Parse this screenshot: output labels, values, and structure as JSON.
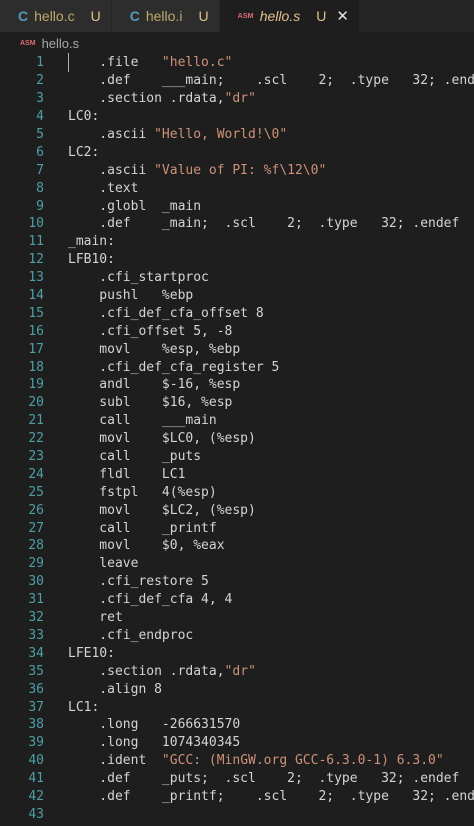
{
  "tabs": [
    {
      "icon": "C",
      "name": "hello.c",
      "status": "U"
    },
    {
      "icon": "C",
      "name": "hello.i",
      "status": "U"
    },
    {
      "icon": "ASM",
      "name": "hello.s",
      "status": "U",
      "close": "✕"
    }
  ],
  "breadcrumb": {
    "icon": "ASM",
    "file": "hello.s"
  },
  "lines": [
    "    .file   \"hello.c\"",
    "    .def    ___main;    .scl    2;  .type   32; .endef",
    "    .section .rdata,\"dr\"",
    "LC0:",
    "    .ascii \"Hello, World!\\0\"",
    "LC2:",
    "    .ascii \"Value of PI: %f\\12\\0\"",
    "    .text",
    "    .globl  _main",
    "    .def    _main;  .scl    2;  .type   32; .endef",
    "_main:",
    "LFB10:",
    "    .cfi_startproc",
    "    pushl   %ebp",
    "    .cfi_def_cfa_offset 8",
    "    .cfi_offset 5, -8",
    "    movl    %esp, %ebp",
    "    .cfi_def_cfa_register 5",
    "    andl    $-16, %esp",
    "    subl    $16, %esp",
    "    call    ___main",
    "    movl    $LC0, (%esp)",
    "    call    _puts",
    "    fldl    LC1",
    "    fstpl   4(%esp)",
    "    movl    $LC2, (%esp)",
    "    call    _printf",
    "    movl    $0, %eax",
    "    leave",
    "    .cfi_restore 5",
    "    .cfi_def_cfa 4, 4",
    "    ret",
    "    .cfi_endproc",
    "LFE10:",
    "    .section .rdata,\"dr\"",
    "    .align 8",
    "LC1:",
    "    .long   -266631570",
    "    .long   1074340345",
    "    .ident  \"GCC: (MinGW.org GCC-6.3.0-1) 6.3.0\"",
    "    .def    _puts;  .scl    2;  .type   32; .endef",
    "    .def    _printf;    .scl    2;  .type   32; .endef",
    ""
  ]
}
